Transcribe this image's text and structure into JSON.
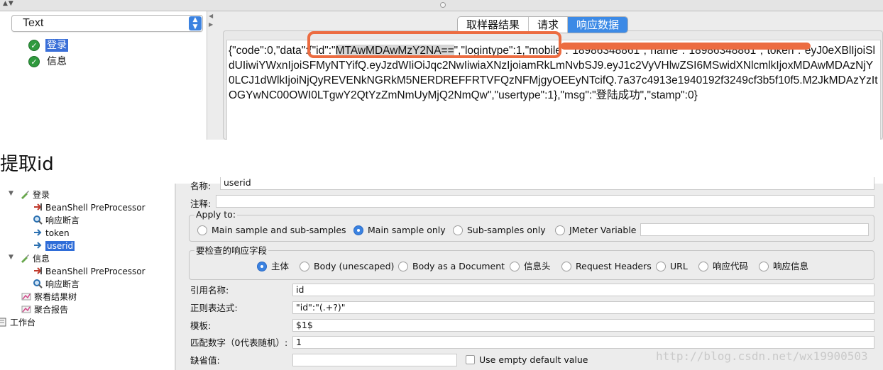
{
  "top": {
    "left_selector": {
      "value": "Text"
    },
    "tree_items": [
      {
        "label": "登录",
        "selected": true
      },
      {
        "label": "信息",
        "selected": false
      }
    ],
    "tabs": [
      {
        "label": "取样器结果",
        "active": false
      },
      {
        "label": "请求",
        "active": false
      },
      {
        "label": "响应数据",
        "active": true
      }
    ],
    "response_text": {
      "before_hl": "{\"code\":0,\"data\":{\"id\":\"",
      "hl": "MTAwMDAwMzY2NA==",
      "after_hl": "\",\"logintype\":1,\"mobile\":\"18986348861\",\"name\":\"18986348861\",\"token\":\"eyJ0eXBlIjoiSldUIiwiYWxnIjoiSFMyNTYifQ.eyJzdWIiOiJqc2NwIiwiaXNzIjoiamRkLmNvbSJ9.eyJ1c2VyVHlwZSI6MSwidXNlcmlkIjoxMDAwMDAzNjY0LCJ1dWlkIjoiNjQyREVENkNGRkM5NERDREFFRTVFQzNFMjgyOEEyNTcifQ.7a37c4913e1940192f3249cf3b5f10f5.M2JkMDAzYzItOGYwNC00OWI0LTgwY2QtYzZmNmUyMjQ2NmQw\",\"usertype\":1},\"msg\":\"登陆成功\",\"stamp\":0}"
    },
    "accent_color": "#ec6c41"
  },
  "caption": "提取id",
  "bottom": {
    "tree": [
      {
        "label": "登录",
        "icon": "pipette-icon"
      },
      {
        "label": "BeanShell PreProcessor",
        "icon": "preprocessor-icon"
      },
      {
        "label": "响应断言",
        "icon": "magnifier-icon"
      },
      {
        "label": "token",
        "icon": "extractor-icon"
      },
      {
        "label": "userid",
        "icon": "extractor-icon",
        "selected": true
      },
      {
        "label": "信息",
        "icon": "pipette-icon"
      },
      {
        "label": "BeanShell PreProcessor",
        "icon": "preprocessor-icon"
      },
      {
        "label": "响应断言",
        "icon": "magnifier-icon"
      },
      {
        "label": "察看结果树",
        "icon": "chart-icon"
      },
      {
        "label": "聚合报告",
        "icon": "chart-icon"
      },
      {
        "label": "工作台",
        "icon": "workbench-icon"
      }
    ],
    "form": {
      "name_label": "名称:",
      "name_value": "userid",
      "comment_label": "注释:",
      "comment_value": "",
      "apply_to": {
        "title": "Apply to:",
        "options": [
          "Main sample and sub-samples",
          "Main sample only",
          "Sub-samples only",
          "JMeter Variable"
        ],
        "selected": "Main sample only",
        "variable_value": ""
      },
      "field_to_check": {
        "title": "要检查的响应字段",
        "options": [
          "主体",
          "Body (unescaped)",
          "Body as a Document",
          "信息头",
          "Request Headers",
          "URL",
          "响应代码",
          "响应信息"
        ],
        "selected": "主体"
      },
      "ref_name": {
        "label": "引用名称:",
        "value": "id"
      },
      "regex": {
        "label": "正则表达式:",
        "value": "\"id\":\"(.+?)\""
      },
      "template": {
        "label": "模板:",
        "value": "$1$"
      },
      "match_no": {
        "label": "匹配数字（0代表随机）:",
        "value": "1"
      },
      "default": {
        "label": "缺省值:",
        "value": "",
        "use_empty_label": "Use empty default value"
      }
    },
    "watermark": "http://blog.csdn.net/wx19900503"
  }
}
